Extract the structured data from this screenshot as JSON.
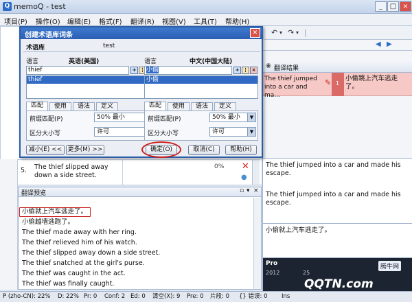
{
  "window": {
    "title": "memoQ - test",
    "icon_label": "Q",
    "buttons": [
      "_",
      "□",
      "×"
    ]
  },
  "menu": [
    "项目(P)",
    "操作(O)",
    "编辑(E)",
    "格式(F)",
    "翻译(R)",
    "视图(V)",
    "工具(T)",
    "帮助(H)"
  ],
  "toolbar_glyphs": [
    "↶",
    "▾",
    "↷",
    "▾",
    "|"
  ],
  "dialog": {
    "title": "创建术语库词条",
    "termbase_label": "术语库",
    "termbase_name": "test",
    "left": {
      "lang_label": "语言",
      "lang_value": "英语(美国)",
      "term_input": "thief",
      "term_list": [
        "thief"
      ]
    },
    "right": {
      "lang_label": "语言",
      "lang_value": "中文(中国大陆)",
      "term_input": "小偷",
      "term_list": [
        "小偷"
      ]
    },
    "tabs": [
      "匹配",
      "使用",
      "语法",
      "定义"
    ],
    "match_label": "前缀匹配(P)",
    "match_value": "50% 最小",
    "case_label": "区分大小写",
    "case_value": "许可",
    "btn_less": "减小(E) <<",
    "btn_more": "更多(M) >>",
    "btn_ok": "确定(O)",
    "btn_cancel": "取消(C)",
    "btn_help": "帮助(H)"
  },
  "segment5": {
    "num": "5.",
    "text": "The thief slipped away down a side street.",
    "percent": "0%"
  },
  "results": {
    "title": "翻译结果",
    "src": "The thief jumped into a car and ma...",
    "tgt": "小偷跳上汽车逃走了。",
    "match_num": "1"
  },
  "right_rows": [
    "The thief jumped into a car and made his escape.",
    "The thief jumped into a car and made his escape.",
    "小偷就上汽车逃走了。"
  ],
  "preview": {
    "title": "翻译预览",
    "lines": [
      "小偷就上汽车逃走了。",
      "小偷越墙逃跑了。",
      "The thief made away with her ring.",
      "The thief relieved him of his watch.",
      "The thief slipped away down a side street.",
      "The thief snatched at the girl's purse.",
      "The thief was caught in the act.",
      "The thief was finally caught."
    ]
  },
  "pro_panel": {
    "label": "Pro",
    "year": "2012",
    "suffix": "25"
  },
  "watermark": {
    "brand": "QQTN.com",
    "badge": "腾牛网"
  },
  "status": [
    "P (zho-CN): 22%",
    "D: 22%",
    "Pr: 0",
    "Conf: 2",
    "Ed: 0",
    "清空(X): 9",
    "Pre: 0",
    "片段: 0",
    "{} 错误: 0",
    "Ins"
  ],
  "colors": {
    "dialog_title": "#2a5eb3",
    "highlight_row": "#f6c9c6",
    "selection": "#316ac5",
    "red_ellipse": "#cc1f1f"
  }
}
